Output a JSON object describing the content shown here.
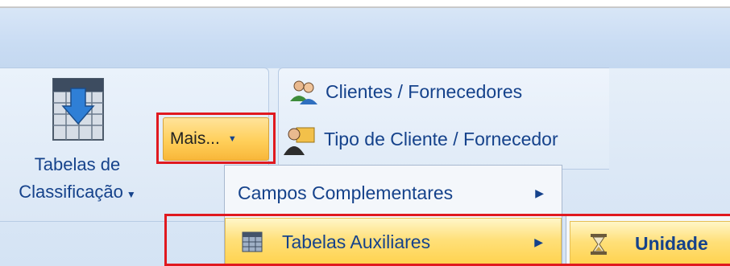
{
  "ribbon": {
    "classification_button": {
      "line1": "Tabelas de",
      "line2": "Classificação",
      "icon": "table-download-icon"
    },
    "more_button": {
      "label": "Mais...",
      "icon": "chevron-down-icon"
    },
    "small_buttons": [
      {
        "label": "Clientes / Fornecedores",
        "icon": "users-icon"
      },
      {
        "label": "Tipo de Cliente / Fornecedor",
        "icon": "user-folder-icon"
      }
    ]
  },
  "more_menu": {
    "items": [
      {
        "label": "Campos Complementares",
        "has_submenu": true
      },
      {
        "label": "Tabelas Auxiliares",
        "has_submenu": true,
        "highlighted": true,
        "icon": "calendar-grid-icon"
      }
    ]
  },
  "submenu": {
    "items": [
      {
        "label": "Unidade",
        "icon": "hourglass-icon",
        "highlighted": true
      }
    ]
  },
  "colors": {
    "highlight_red": "#e0191f",
    "ribbon_blue": "#dce8f6",
    "text_blue": "#15428b",
    "hover_yellow": "#ffd24d"
  }
}
